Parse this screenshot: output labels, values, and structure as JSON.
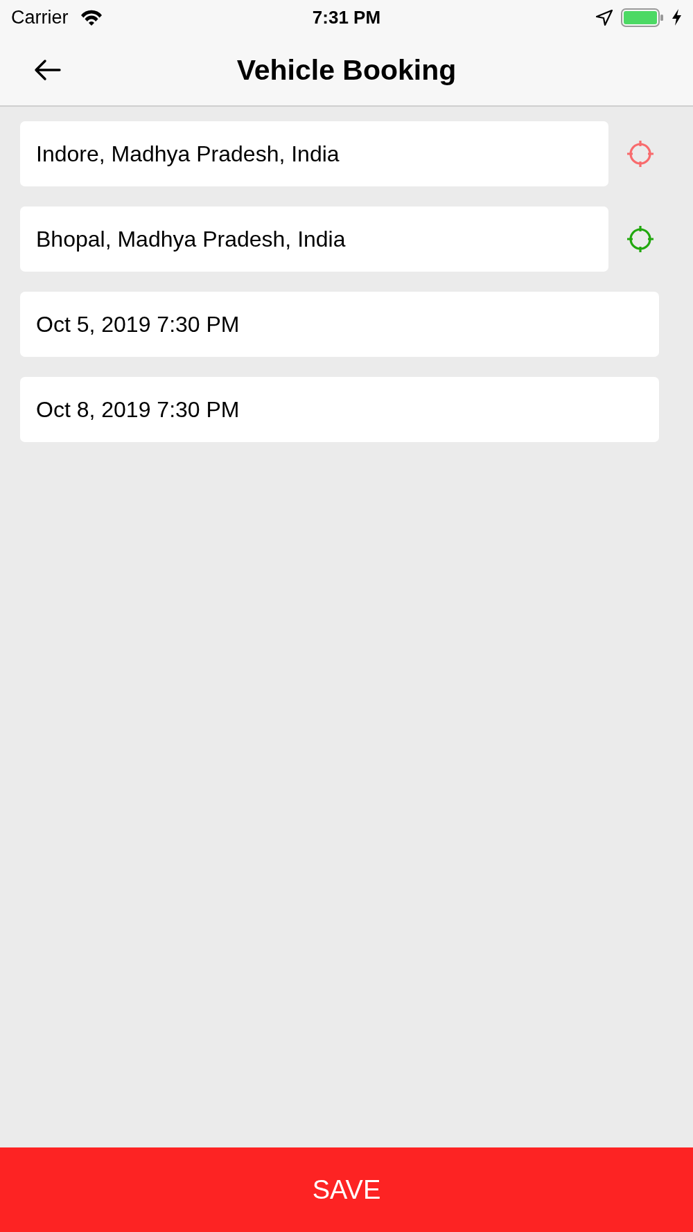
{
  "status_bar": {
    "carrier": "Carrier",
    "time": "7:31 PM"
  },
  "nav_bar": {
    "title": "Vehicle Booking"
  },
  "fields": [
    {
      "kind": "location",
      "value": "Indore, Madhya Pradesh, India",
      "color": "#f86b6d"
    },
    {
      "kind": "location",
      "value": "Bhopal, Madhya Pradesh, India",
      "color": "#22a80f"
    },
    {
      "kind": "date",
      "value": "Oct 5, 2019 7:30 PM"
    },
    {
      "kind": "date",
      "value": "Oct 8, 2019 7:30 PM"
    }
  ],
  "save_button": {
    "label": "SAVE"
  }
}
